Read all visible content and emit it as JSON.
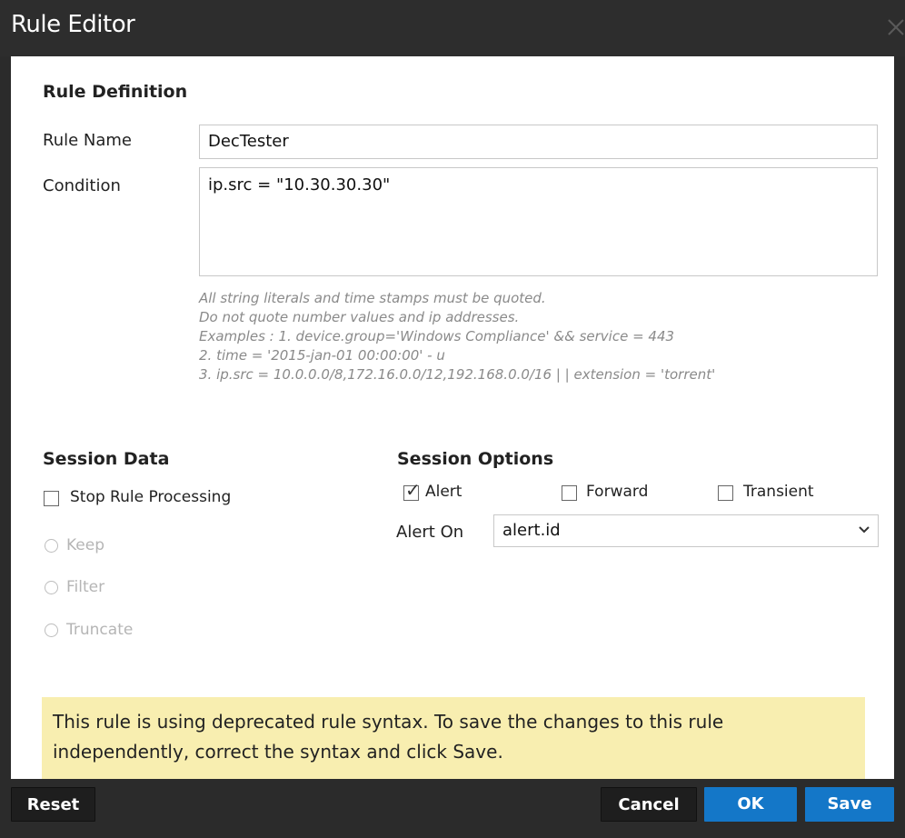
{
  "dialog": {
    "title": "Rule Editor",
    "close_icon": "close-icon"
  },
  "definition": {
    "heading": "Rule Definition",
    "rule_name_label": "Rule Name",
    "rule_name_value": "DecTester",
    "condition_label": "Condition",
    "condition_value": "ip.src = \"10.30.30.30\"",
    "hints": [
      "All string literals and time stamps must be quoted.",
      "Do not quote number values and ip addresses.",
      "Examples : 1. device.group='Windows Compliance' && service = 443",
      "2. time = '2015-jan-01 00:00:00' - u",
      "3. ip.src = 10.0.0.0/8,172.16.0.0/12,192.168.0.0/16 | | extension = 'torrent'"
    ]
  },
  "session_data": {
    "heading": "Session Data",
    "stop_rule_processing": {
      "label": "Stop Rule Processing",
      "checked": false
    },
    "radios": [
      {
        "label": "Keep",
        "selected": false,
        "disabled": true
      },
      {
        "label": "Filter",
        "selected": false,
        "disabled": true
      },
      {
        "label": "Truncate",
        "selected": false,
        "disabled": true
      }
    ]
  },
  "session_options": {
    "heading": "Session Options",
    "alert": {
      "label": "Alert",
      "checked": true
    },
    "forward": {
      "label": "Forward",
      "checked": false
    },
    "transient": {
      "label": "Transient",
      "checked": false
    },
    "alert_on_label": "Alert On",
    "alert_on_value": "alert.id"
  },
  "warning": {
    "text": "This rule is using deprecated rule syntax. To save the changes to this rule independently, correct the syntax and click Save.",
    "bg_color": "#f8eeb0"
  },
  "footer": {
    "reset_label": "Reset",
    "cancel_label": "Cancel",
    "ok_label": "OK",
    "save_label": "Save",
    "accent_color": "#1477c8"
  }
}
